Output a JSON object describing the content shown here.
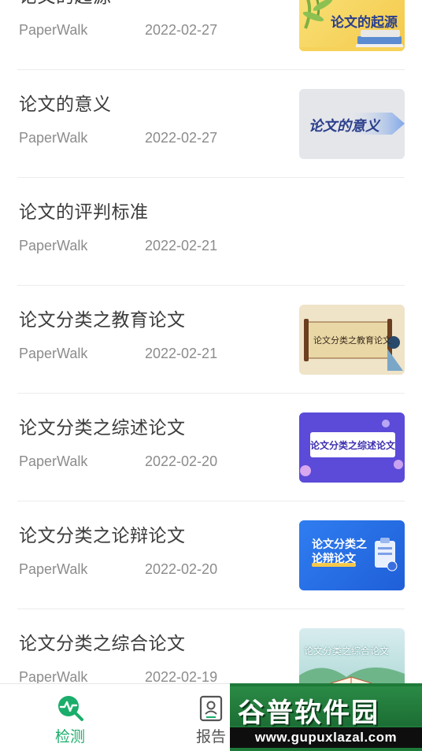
{
  "articles": [
    {
      "title": "论文的起源",
      "author": "PaperWalk",
      "date": "2022-02-27",
      "thumb_text": "论文的起源",
      "thumb_icon": "books-bamboo"
    },
    {
      "title": "论文的意义",
      "author": "PaperWalk",
      "date": "2022-02-27",
      "thumb_text": "论文的意义",
      "thumb_icon": "arrow"
    },
    {
      "title": "论文的评判标准",
      "author": "PaperWalk",
      "date": "2022-02-21"
    },
    {
      "title": "论文分类之教育论文",
      "author": "PaperWalk",
      "date": "2022-02-21",
      "thumb_text": "论文分类之教育论文",
      "thumb_icon": "scroll-figure"
    },
    {
      "title": "论文分类之综述论文",
      "author": "PaperWalk",
      "date": "2022-02-20",
      "thumb_text": "论文分类之综述论文",
      "thumb_icon": "banner"
    },
    {
      "title": "论文分类之论辩论文",
      "author": "PaperWalk",
      "date": "2022-02-20",
      "thumb_text_line1": "论文分类之",
      "thumb_text_line2": "论辩论文",
      "thumb_icon": "clipboard"
    },
    {
      "title": "论文分类之综合论文",
      "author": "PaperWalk",
      "date": "2022-02-19",
      "thumb_text": "论文分类之综合论文",
      "thumb_icon": "open-book"
    }
  ],
  "tabs": [
    {
      "label": "检测",
      "icon": "search-pulse-icon",
      "active": true
    },
    {
      "label": "报告",
      "icon": "report-icon",
      "active": false
    }
  ],
  "watermark": {
    "title": "谷普软件园",
    "url": "www.gupuxlazal.com"
  },
  "colors": {
    "accent": "#1aad6b",
    "text": "#3c3c3c",
    "meta": "#8c8c8c"
  }
}
